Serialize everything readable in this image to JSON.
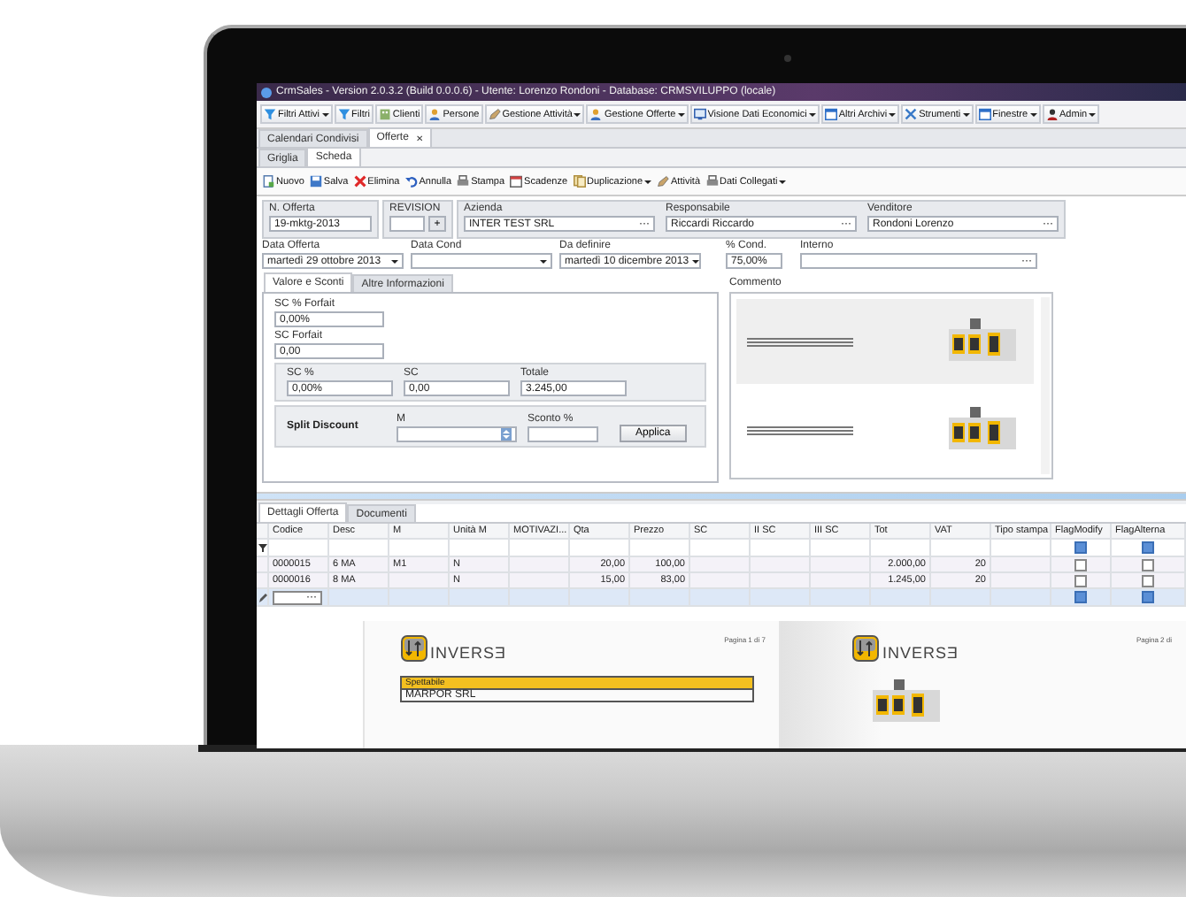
{
  "window": {
    "title": "CrmSales - Version 2.0.3.2 (Build 0.0.0.6) - Utente: Lorenzo Rondoni - Database: CRMSVILUPPO (locale)"
  },
  "menu_toolbar": [
    {
      "label": "Filtri Attivi",
      "dropdown": true
    },
    {
      "label": "Filtri",
      "dropdown": false
    },
    {
      "label": "Clienti",
      "dropdown": false
    },
    {
      "label": "Persone",
      "dropdown": false
    },
    {
      "label": "Gestione Attività",
      "dropdown": true
    },
    {
      "label": "Gestione Offerte",
      "dropdown": true
    },
    {
      "label": "Visione Dati Economici",
      "dropdown": true
    },
    {
      "label": "Altri Archivi",
      "dropdown": true
    },
    {
      "label": "Strumenti",
      "dropdown": true
    },
    {
      "label": "Finestre",
      "dropdown": true
    },
    {
      "label": "Admin",
      "dropdown": true
    }
  ],
  "document_tabs": [
    {
      "label": "Calendari Condivisi",
      "selected": false
    },
    {
      "label": "Offerte",
      "selected": true,
      "close": "✕"
    }
  ],
  "view_tabs": [
    {
      "label": "Griglia",
      "selected": false
    },
    {
      "label": "Scheda",
      "selected": true
    }
  ],
  "action_toolbar": [
    {
      "label": "Nuovo",
      "dropdown": false
    },
    {
      "label": "Salva",
      "dropdown": false
    },
    {
      "label": "Elimina",
      "dropdown": false
    },
    {
      "label": "Annulla",
      "dropdown": false
    },
    {
      "label": "Stampa",
      "dropdown": false
    },
    {
      "label": "Scadenze",
      "dropdown": false
    },
    {
      "label": "Duplicazione",
      "dropdown": true
    },
    {
      "label": "Attività",
      "dropdown": false
    },
    {
      "label": "Dati Collegati",
      "dropdown": true
    }
  ],
  "header_groups": [
    {
      "fields": [
        {
          "label": "N. Offerta",
          "value": "19-mktg-2013",
          "kind": "text"
        }
      ]
    },
    {
      "fields": [
        {
          "label": "REVISION",
          "kind": "spin",
          "button": "+"
        }
      ]
    },
    {
      "fields": [
        {
          "label": "Azienda",
          "value": "INTER TEST SRL",
          "kind": "lookup",
          "button": "···"
        },
        {
          "label": "Responsabile",
          "value": "Riccardi Riccardo",
          "kind": "lookup",
          "button": "···"
        },
        {
          "label": "Venditore",
          "value": "Rondoni Lorenzo",
          "kind": "lookup",
          "button": "···"
        }
      ]
    }
  ],
  "date_fields": [
    {
      "label": "Data Offerta",
      "value": "martedì 29 ottobre 2013",
      "kind": "dropdown"
    },
    {
      "label": "Data Cond",
      "kind": "dropdown"
    },
    {
      "label": "Da definire",
      "value": "martedì 10 dicembre 2013",
      "kind": "dropdown"
    },
    {
      "label": "% Cond.",
      "value": "75,00%",
      "kind": "text"
    },
    {
      "label": "Interno",
      "kind": "lookup",
      "button": "···"
    }
  ],
  "discount_tabs": [
    {
      "label": "Valore e Sconti",
      "selected": true
    },
    {
      "label": "Altre Informazioni",
      "selected": false
    }
  ],
  "forfait_fields": [
    {
      "label": "SC % Forfait",
      "value": "0,00%"
    },
    {
      "label": "SC Forfait",
      "value": "0,00"
    }
  ],
  "totals_group": [
    {
      "label": "SC %",
      "value": "0,00%"
    },
    {
      "label": "SC",
      "value": "0,00"
    },
    {
      "label": "Totale",
      "value": "3.245,00"
    }
  ],
  "split_discount": {
    "title": "Split Discount",
    "m_label": "M",
    "sconto_label": "Sconto %",
    "apply_button": "Applica"
  },
  "comment": {
    "label": "Commento"
  },
  "detail_tabs": [
    {
      "label": "Dettagli Offerta",
      "selected": true
    },
    {
      "label": "Documenti",
      "selected": false
    }
  ],
  "grid": {
    "columns": [
      {
        "label": "Codice",
        "kind": "text"
      },
      {
        "label": "Desc",
        "kind": "text"
      },
      {
        "label": "M",
        "kind": "text"
      },
      {
        "label": "Unità M",
        "kind": "text"
      },
      {
        "label": "MOTIVAZI...",
        "kind": "text"
      },
      {
        "label": "Qta",
        "kind": "number"
      },
      {
        "label": "Prezzo",
        "kind": "number"
      },
      {
        "label": "SC",
        "kind": "number"
      },
      {
        "label": "II SC",
        "kind": "number"
      },
      {
        "label": "III SC",
        "kind": "number"
      },
      {
        "label": "Tot",
        "kind": "number"
      },
      {
        "label": "VAT",
        "kind": "number"
      },
      {
        "label": "Tipo stampa",
        "kind": "text"
      },
      {
        "label": "FlagModify",
        "kind": "flag"
      },
      {
        "label": "FlagAlterna",
        "kind": "flag"
      }
    ],
    "rows": [
      {
        "kind": "filter",
        "selected": false,
        "cells": [
          null,
          null,
          null,
          null,
          null,
          null,
          null,
          null,
          null,
          null,
          null,
          null,
          null,
          {
            "indeterminate": true
          },
          {
            "indeterminate": true
          }
        ]
      },
      {
        "kind": "data",
        "selected": false,
        "cells": [
          "0000015",
          "6 MA",
          "M1",
          "N",
          null,
          "20,00",
          "100,00",
          null,
          null,
          null,
          "2.000,00",
          "20",
          null,
          {
            "checked": false
          },
          {
            "checked": false
          }
        ]
      },
      {
        "kind": "data",
        "selected": false,
        "cells": [
          "0000016",
          "8 MA",
          null,
          "N",
          null,
          "15,00",
          "83,00",
          null,
          null,
          null,
          "1.245,00",
          "20",
          null,
          {
            "checked": false
          },
          {
            "checked": false
          }
        ]
      },
      {
        "kind": "new",
        "selected": true,
        "editor_button": "···",
        "cells": [
          null,
          null,
          null,
          null,
          null,
          null,
          null,
          null,
          null,
          null,
          null,
          null,
          null,
          {
            "indeterminate": true
          },
          {
            "indeterminate": true
          }
        ]
      }
    ]
  },
  "report_preview": {
    "pages": [
      {
        "kind": "letter",
        "page_label": "Pagina 1 di 7",
        "logo": "INVERSƎ",
        "addressee_heading": "Spettabile",
        "addressee": "MARPOR SRL"
      },
      {
        "kind": "cover",
        "page_label": "Pagina 2 di",
        "logo": "INVERSƎ"
      }
    ]
  }
}
